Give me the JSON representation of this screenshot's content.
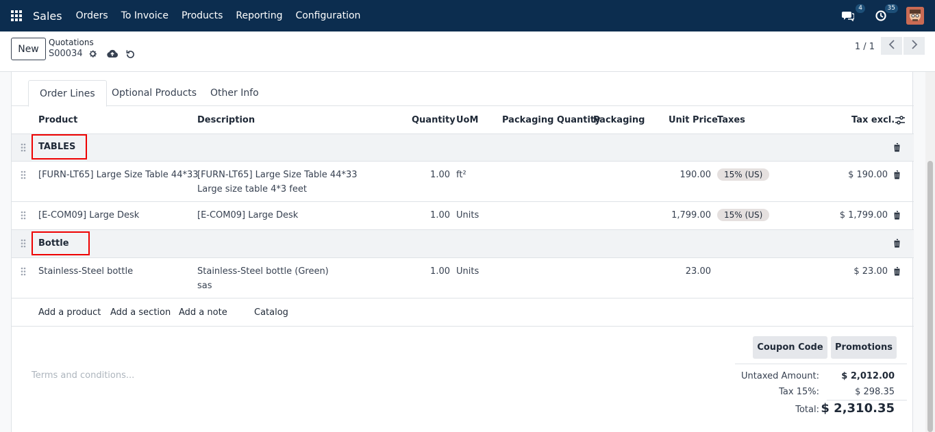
{
  "navbar": {
    "brand": "Sales",
    "menu": [
      "Orders",
      "To Invoice",
      "Products",
      "Reporting",
      "Configuration"
    ],
    "messages_count": "4",
    "activities_count": "35"
  },
  "control": {
    "new_label": "New",
    "breadcrumb": "Quotations",
    "record": "S00034",
    "pager": "1 / 1"
  },
  "tabs": [
    "Order Lines",
    "Optional Products",
    "Other Info"
  ],
  "columns": {
    "product": "Product",
    "description": "Description",
    "quantity": "Quantity",
    "uom": "UoM",
    "packaging_qty": "Packaging Quantity",
    "packaging": "Packaging",
    "unit_price": "Unit Price",
    "taxes": "Taxes",
    "tax_excl": "Tax excl."
  },
  "lines": {
    "section1": "TABLES",
    "l1": {
      "product": "[FURN-LT65] Large Size Table 44*33",
      "desc1": "[FURN-LT65] Large Size Table 44*33",
      "desc2": "Large size table 4*3 feet",
      "qty": "1.00",
      "uom": "ft²",
      "price": "190.00",
      "tax": "15% (US)",
      "subtotal": "$ 190.00"
    },
    "l2": {
      "product": "[E-COM09] Large Desk",
      "desc1": "[E-COM09] Large Desk",
      "qty": "1.00",
      "uom": "Units",
      "price": "1,799.00",
      "tax": "15% (US)",
      "subtotal": "$ 1,799.00"
    },
    "section2": "Bottle",
    "l3": {
      "product": "Stainless-Steel bottle",
      "desc1": "Stainless-Steel bottle (Green)",
      "desc2": "sas",
      "qty": "1.00",
      "uom": "Units",
      "price": "23.00",
      "subtotal": "$ 23.00"
    }
  },
  "add_links": {
    "product": "Add a product",
    "section": "Add a section",
    "note": "Add a note",
    "catalog": "Catalog"
  },
  "buttons": {
    "coupon": "Coupon Code",
    "promotions": "Promotions"
  },
  "terms_placeholder": "Terms and conditions...",
  "totals": {
    "untaxed_label": "Untaxed Amount:",
    "untaxed": "$ 2,012.00",
    "tax_label": "Tax 15%:",
    "tax": "$ 298.35",
    "total_label": "Total:",
    "total": "$ 2,310.35"
  },
  "colors": {
    "navbar": "#0c2d4f",
    "highlight": "#ee0000"
  }
}
